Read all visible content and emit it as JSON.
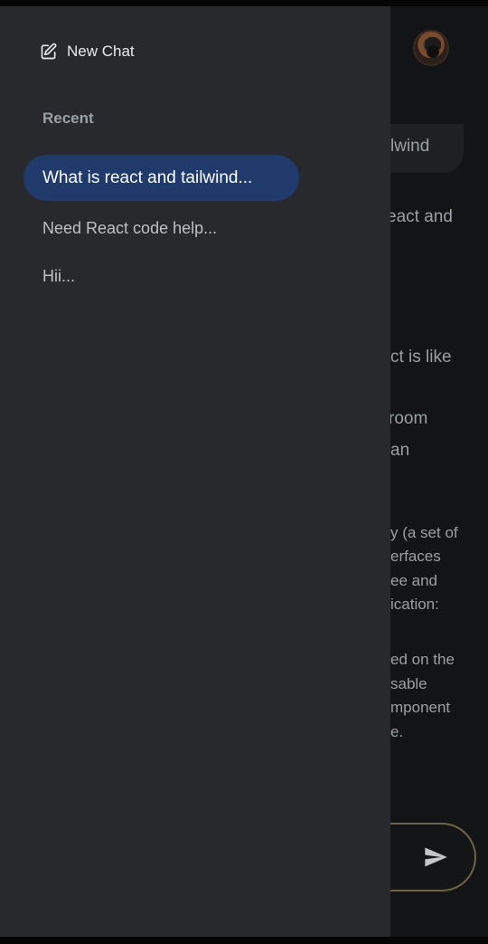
{
  "drawer": {
    "new_chat_label": "New Chat",
    "recent_label": "Recent",
    "history": [
      {
        "label": "What is react and tailwind...",
        "active": true
      },
      {
        "label": "Need React code help..."
      },
      {
        "label": "Hii..."
      }
    ]
  },
  "chat_background": {
    "user_bubble_fragment": "lwind",
    "lines": [
      "eact and",
      "ct is like",
      "room",
      "an",
      "y (a set of",
      "erfaces",
      "ee and",
      "ication:",
      "ed on the",
      "sable",
      "mponent",
      "e."
    ]
  },
  "colors": {
    "drawer_bg": "#28292c",
    "active_item_bg": "#1f3a6b",
    "input_border": "#6e6346"
  },
  "icons": {
    "new_chat": "edit-square-icon",
    "send": "send-icon",
    "avatar": "user-avatar"
  }
}
